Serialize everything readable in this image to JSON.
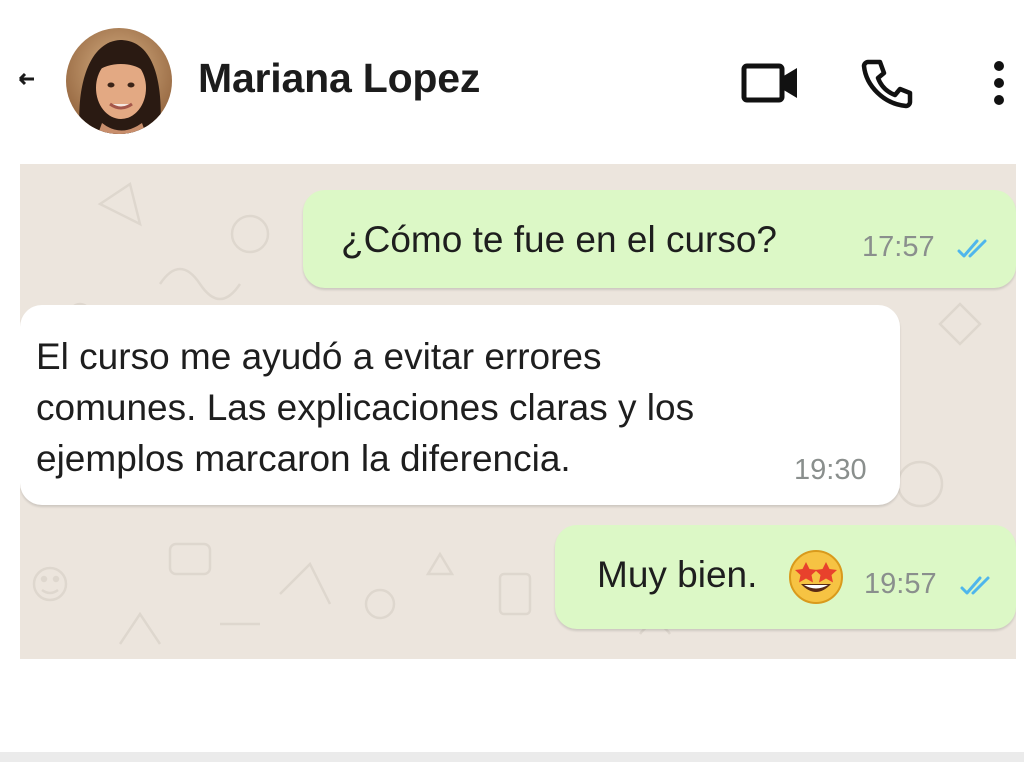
{
  "header": {
    "contact_name": "Mariana Lopez",
    "icons": {
      "back": "back-arrow-icon",
      "video": "video-call-icon",
      "call": "phone-call-icon",
      "more": "more-vertical-icon"
    }
  },
  "colors": {
    "outgoing_bubble": "#dcf8c6",
    "incoming_bubble": "#ffffff",
    "chat_background": "#ece5dd",
    "read_ticks": "#4fb6ec",
    "timestamp": "#8a8f8d"
  },
  "messages": [
    {
      "direction": "outgoing",
      "text": "¿Cómo te fue en el curso?",
      "time": "17:57",
      "status": "read"
    },
    {
      "direction": "incoming",
      "text": "El curso me ayudó a evitar errores\ncomunes. Las explicaciones claras y los\nejemplos marcaron la diferencia.",
      "time": "19:30"
    },
    {
      "direction": "outgoing",
      "text": "Muy bien.",
      "emoji": "star-struck-emoji",
      "time": "19:57",
      "status": "read"
    }
  ]
}
